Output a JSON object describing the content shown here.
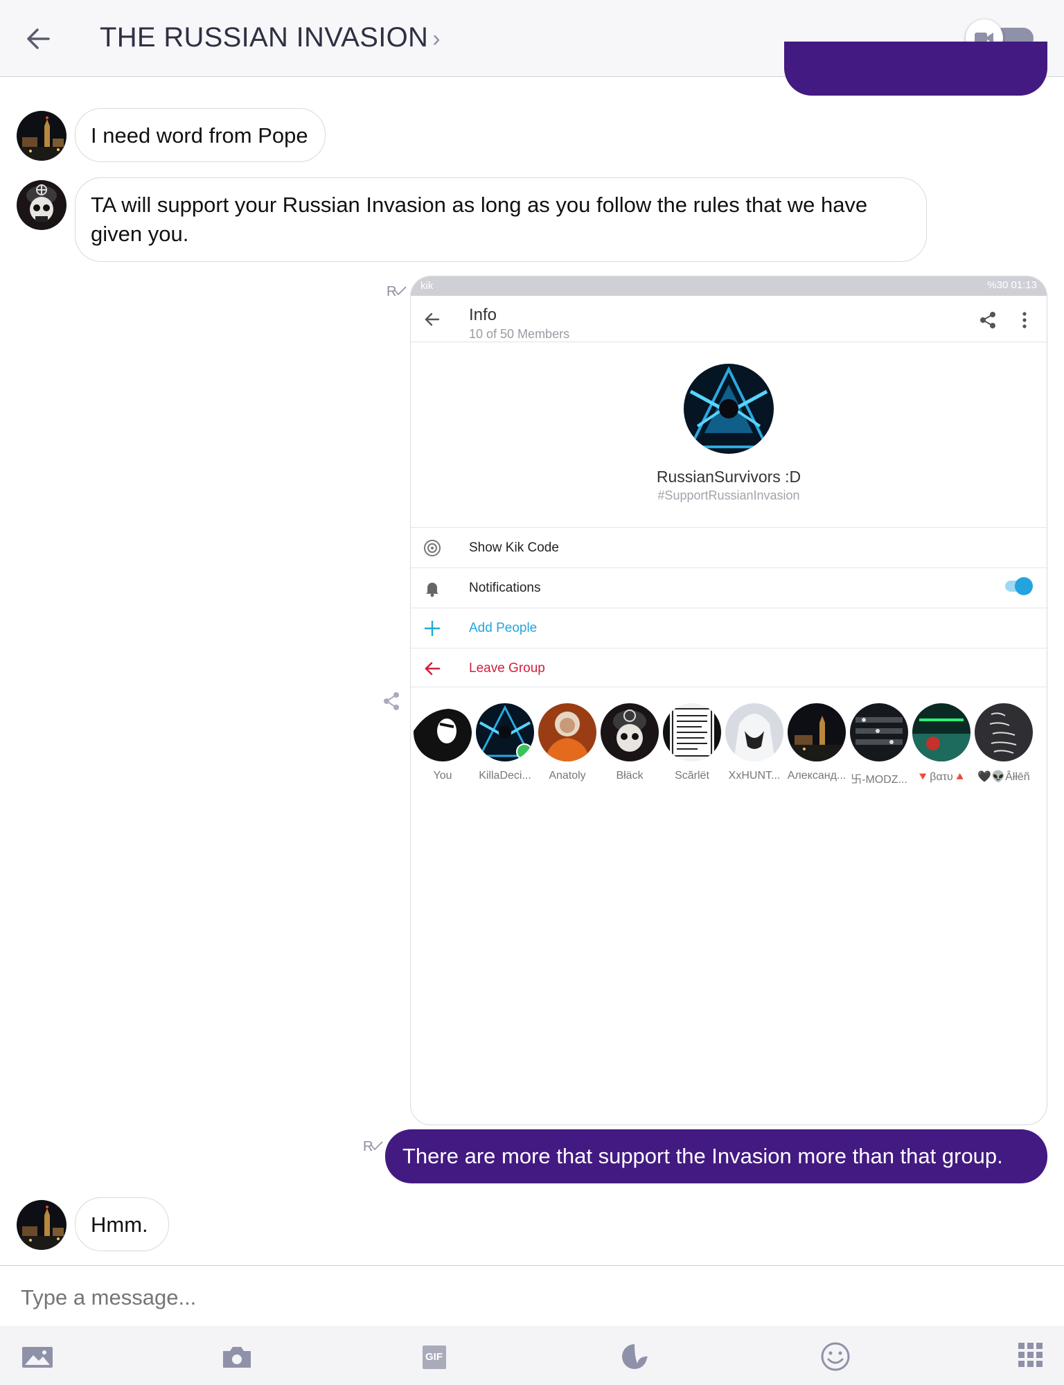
{
  "header": {
    "title": "THE RUSSIAN INVASION",
    "title_chevron": "›"
  },
  "messages": {
    "msg1": "I need word from Pope",
    "msg2": "TA will support your Russian Invasion as long as you follow the rules that we have given you.",
    "msg3": "There are more that support the Invasion more than that group.",
    "msg4": "Hmm.",
    "receipt": "R"
  },
  "screenshot": {
    "status_left": "kik",
    "status_right": "%30 01:13",
    "appbar_title": "Info",
    "appbar_sub": "10 of 50 Members",
    "group_name": "RussianSurvivors :D",
    "group_tag": "#SupportRussianInvasion",
    "rows": {
      "kik_code": "Show Kik Code",
      "notifications": "Notifications",
      "add_people": "Add People",
      "leave_group": "Leave Group"
    },
    "members": [
      "You",
      "KillaDeci...",
      "Anatoly",
      "Błäck",
      "Scărlët",
      "XxHUNT...",
      "Александ...",
      "卐-MODZ...",
      "🔻βατυ🔺",
      "🖤👽Âłłēñ"
    ]
  },
  "composer": {
    "placeholder": "Type a message..."
  },
  "toolbar": {
    "gif_label": "GIF"
  },
  "colors": {
    "outgoing_bubble": "#431a82",
    "kik_blue": "#21a7dd",
    "leave_red": "#d01f3c"
  }
}
